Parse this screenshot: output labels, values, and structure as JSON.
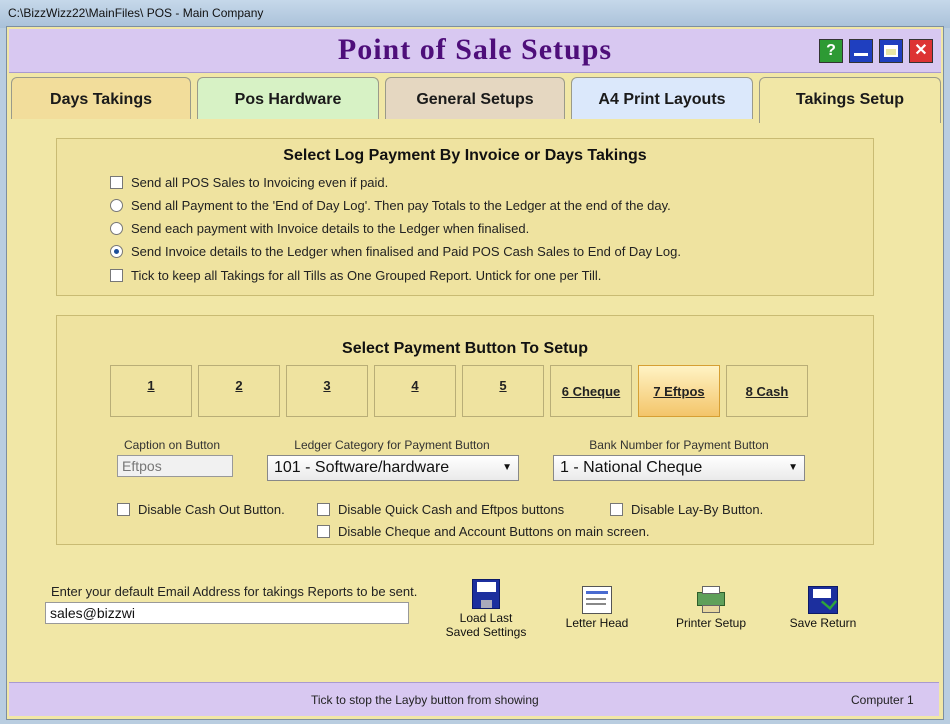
{
  "window": {
    "title": "C:\\BizzWizz22\\MainFiles\\ POS - Main Company"
  },
  "header": {
    "title": "Point  of  Sale  Setups"
  },
  "controls": {
    "help": "?"
  },
  "tabs": [
    {
      "label": "Days Takings",
      "color": "#f2dd9b"
    },
    {
      "label": "Pos Hardware",
      "color": "#d7f2c5"
    },
    {
      "label": "General Setups",
      "color": "#e5d7c1"
    },
    {
      "label": "A4 Print Layouts",
      "color": "#dbe8fb"
    },
    {
      "label": "Takings Setup",
      "color": "#f1e7a6"
    }
  ],
  "log_payment": {
    "title": "Select Log Payment By Invoice or Days Takings",
    "options": [
      {
        "type": "checkbox",
        "checked": false,
        "label": "Send all POS Sales to Invoicing even if paid."
      },
      {
        "type": "radio",
        "checked": false,
        "label": "Send all Payment to the 'End of Day Log'.  Then pay Totals to the Ledger at the end of the day."
      },
      {
        "type": "radio",
        "checked": false,
        "label": "Send each payment with Invoice details to the Ledger when finalised."
      },
      {
        "type": "radio",
        "checked": true,
        "label": "Send Invoice details to the Ledger when finalised and Paid POS Cash Sales to End of Day Log."
      },
      {
        "type": "checkbox",
        "checked": false,
        "label": "Tick to keep all Takings for all Tills as One Grouped Report.  Untick for one per Till."
      }
    ]
  },
  "payment_buttons": {
    "title": "Select Payment Button To Setup",
    "buttons": [
      "1",
      "2",
      "3",
      "4",
      "5",
      "6 Cheque",
      "7 Eftpos",
      "8 Cash"
    ],
    "selected_index": 6,
    "caption_label": "Caption on Button",
    "caption_value": "Eftpos",
    "ledger_label": "Ledger Category for Payment Button",
    "ledger_value": "101 - Software/hardware",
    "bank_label": "Bank Number for Payment Button",
    "bank_value": "1 - National Cheque",
    "disable_options": [
      {
        "label": "Disable Cash Out Button.",
        "checked": false
      },
      {
        "label": "Disable Quick Cash and Eftpos buttons",
        "checked": false
      },
      {
        "label": "Disable Lay-By Button.",
        "checked": false
      },
      {
        "label": "Disable Cheque and Account Buttons on main screen.",
        "checked": false
      }
    ]
  },
  "email": {
    "label": "Enter your default Email Address for takings Reports to be sent.",
    "value": "sales@bizzwi"
  },
  "toolbar": {
    "load_last": "Load Last",
    "load_last2": "Saved Settings",
    "letter_head": "Letter Head",
    "printer_setup": "Printer Setup",
    "save_return": "Save Return"
  },
  "status": {
    "message": "Tick to stop the Layby button from showing",
    "computer": "Computer 1"
  }
}
